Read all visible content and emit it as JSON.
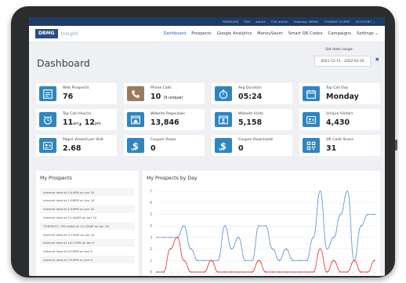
{
  "utility_bar": [
    "FRANÇAIS",
    "FAQ",
    "admin",
    "Full admin",
    "Viewing: DRMG",
    "CHANGE CLIENT",
    "ACCOUNT ⌄"
  ],
  "brand": {
    "logo": "DRMG",
    "product": "Insight"
  },
  "nav": {
    "items": [
      "Dashboard",
      "Prospects",
      "Google Analytics",
      "MoneySaver",
      "Smart QR Codes",
      "Campaigns",
      "Settings ⌄"
    ],
    "active": "Dashboard"
  },
  "page": {
    "title": "Dashboard"
  },
  "date_range": {
    "label": "Set date range:",
    "value": "2021-12-11 - 2022-01-10",
    "clear": "✖"
  },
  "colors": {
    "brand_navy": "#1e3b66",
    "accent_blue": "#2b5fb4",
    "icon_blue": "#2e86c1",
    "icon_brown": "#9c7a5e",
    "line_blue": "#6f9bd1",
    "line_red": "#e24a4a"
  },
  "cards": [
    {
      "label": "Web Prospects",
      "value": "76",
      "icon": "web-form-icon",
      "color": "#2e86c1"
    },
    {
      "label": "Phone Calls",
      "value": "10",
      "value_suffix": "(9 unique)",
      "icon": "phone-icon",
      "color": "#9c7a5e"
    },
    {
      "label": "Avg Duration",
      "value": "05:24",
      "icon": "stopwatch-icon",
      "color": "#2e86c1"
    },
    {
      "label": "Top Call Day",
      "value": "Monday",
      "icon": "calendar-icon",
      "color": "#2e86c1"
    },
    {
      "label": "Top Call Hour(s)",
      "value_parts": [
        "11",
        "am",
        ", 12",
        "pm"
      ],
      "icon": "alarm-clock-icon",
      "color": "#2e86c1"
    },
    {
      "label": "Website Pageviews",
      "value": "13,846",
      "icon": "browser-home-icon",
      "color": "#2e86c1"
    },
    {
      "label": "Website Visits",
      "value": "5,158",
      "icon": "browser-user-icon",
      "color": "#2e86c1"
    },
    {
      "label": "Unique Visitors",
      "value": "4,430",
      "icon": "user-card-icon",
      "color": "#2e86c1"
    },
    {
      "label": "Pages Viewed per Visit",
      "value": "2.68",
      "icon": "user-card-icon",
      "color": "#2e86c1"
    },
    {
      "label": "Coupon Views",
      "value": "0",
      "icon": "coupon-dollar-icon",
      "color": "#2e86c1"
    },
    {
      "label": "Coupon Downloads",
      "value": "0",
      "icon": "coupon-dollar-icon",
      "color": "#2e86c1"
    },
    {
      "label": "QR Code Scans",
      "value": "31",
      "icon": "qr-code-icon",
      "color": "#2e86c1"
    }
  ],
  "prospects": {
    "title": "My Prospects",
    "items": [
      "internet lead at 2:44PM on Jan 10",
      "internet lead at 1:58PM on Jan 10",
      "internet lead at 1:49PM on Jan 10",
      "internet lead at 11:40AM on Jan 10",
      "TORONTO, ON called at 11:25AM on Jan 10",
      "internet lead at 9:15AM on Jan 10",
      "internet lead at 10:17PM on Jan 9",
      "internet lead at 9:29PM on Jan 9",
      "internet lead at 5:52PM on Jan 9"
    ]
  },
  "chart_data": {
    "type": "line",
    "title": "My Prospects by Day",
    "ylim": [
      0,
      7
    ],
    "y_ticks": [
      0,
      1,
      2,
      3,
      4,
      5,
      6,
      7
    ],
    "x_count": 31,
    "series": [
      {
        "color": "#6f9bd1",
        "values": [
          3,
          3,
          3,
          3,
          4,
          2,
          1,
          1,
          1,
          1,
          4,
          2,
          3,
          1,
          1,
          4,
          4,
          2,
          1,
          2,
          1,
          1,
          1,
          3,
          7,
          2,
          3,
          5,
          7,
          1,
          4,
          5,
          5
        ]
      },
      {
        "color": "#e24a4a",
        "values": [
          0,
          0,
          2,
          3,
          1,
          0,
          0,
          0,
          1,
          0,
          0,
          0,
          0,
          0,
          0,
          1,
          0,
          0,
          0,
          0,
          0,
          0,
          0,
          0,
          2,
          0,
          1,
          0,
          0,
          1,
          0,
          0,
          1
        ]
      }
    ],
    "grid": true,
    "legend": "none"
  }
}
